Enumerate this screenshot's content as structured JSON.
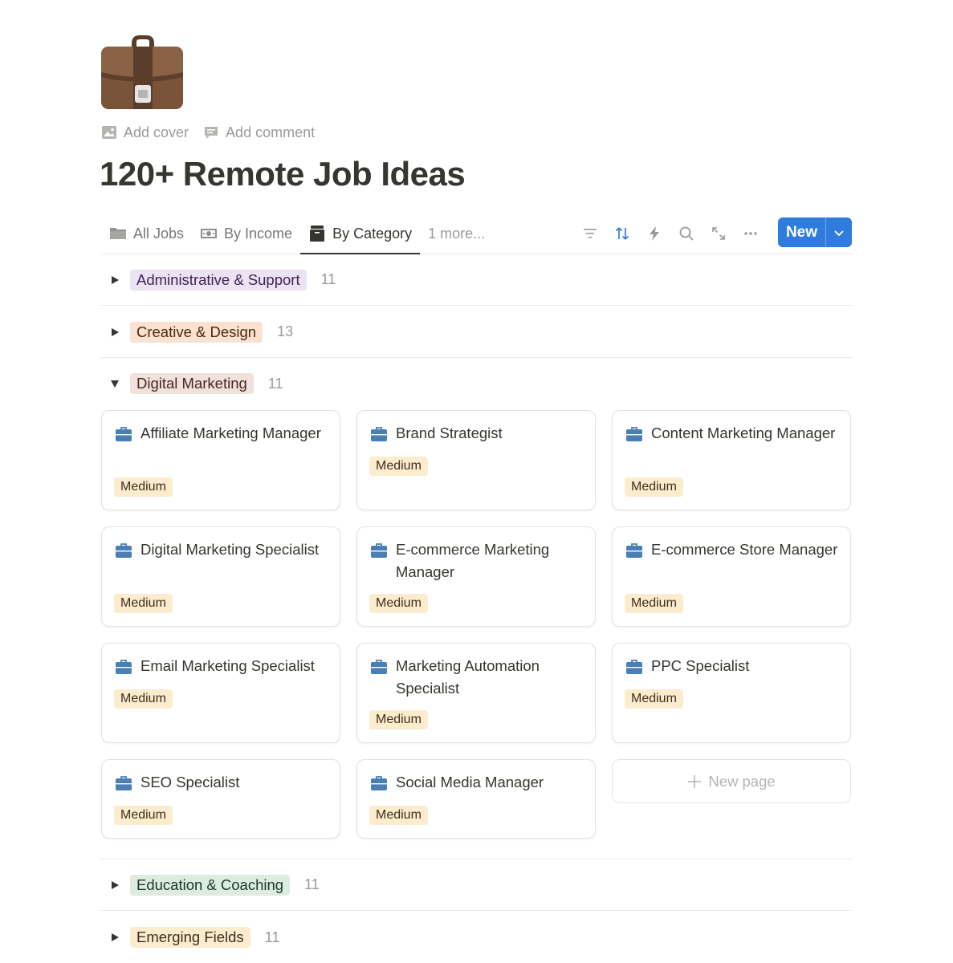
{
  "page": {
    "icon": "briefcase-emoji",
    "add_cover": "Add cover",
    "add_comment": "Add comment",
    "title": "120+ Remote Job Ideas"
  },
  "views": {
    "tabs": [
      {
        "label": "All Jobs",
        "icon": "folder-icon"
      },
      {
        "label": "By Income",
        "icon": "money-icon"
      },
      {
        "label": "By Category",
        "icon": "filing-cabinet-icon",
        "active": true
      }
    ],
    "more": "1 more...",
    "tools": [
      "filter-icon",
      "sort-icon",
      "automation-bolt-icon",
      "search-icon",
      "expand-icon",
      "more-icon"
    ],
    "new_button": "New",
    "accent_color": "#2e7dde"
  },
  "groups": [
    {
      "label": "Administrative & Support",
      "count": "11",
      "expanded": false,
      "bg": "#ebe3f2",
      "fg": "#412454"
    },
    {
      "label": "Creative & Design",
      "count": "13",
      "expanded": false,
      "bg": "#fbe1cf",
      "fg": "#49290e"
    },
    {
      "label": "Digital Marketing",
      "count": "11",
      "expanded": true,
      "bg": "#f1e1dc",
      "fg": "#44291f"
    },
    {
      "label": "Education & Coaching",
      "count": "11",
      "expanded": false,
      "bg": "#dcecdf",
      "fg": "#1c3829"
    },
    {
      "label": "Emerging Fields",
      "count": "11",
      "expanded": false,
      "bg": "#fbeccd",
      "fg": "#402c1b"
    }
  ],
  "cards": [
    {
      "title": "Affiliate Marketing Manager",
      "tag": "Medium"
    },
    {
      "title": "Brand Strategist",
      "tag": "Medium"
    },
    {
      "title": "Content Marketing Manager",
      "tag": "Medium"
    },
    {
      "title": "Digital Marketing Specialist",
      "tag": "Medium"
    },
    {
      "title": "E-commerce Marketing Manager",
      "tag": "Medium"
    },
    {
      "title": "E-commerce Store Manager",
      "tag": "Medium"
    },
    {
      "title": "Email Marketing Specialist",
      "tag": "Medium"
    },
    {
      "title": "Marketing Automation Specialist",
      "tag": "Medium"
    },
    {
      "title": "PPC Specialist",
      "tag": "Medium"
    },
    {
      "title": "SEO Specialist",
      "tag": "Medium"
    },
    {
      "title": "Social Media Manager",
      "tag": "Medium"
    }
  ],
  "new_page": "New page",
  "colors": {
    "tag_medium_bg": "#fbeccd",
    "card_icon": "#4a7fb5"
  }
}
